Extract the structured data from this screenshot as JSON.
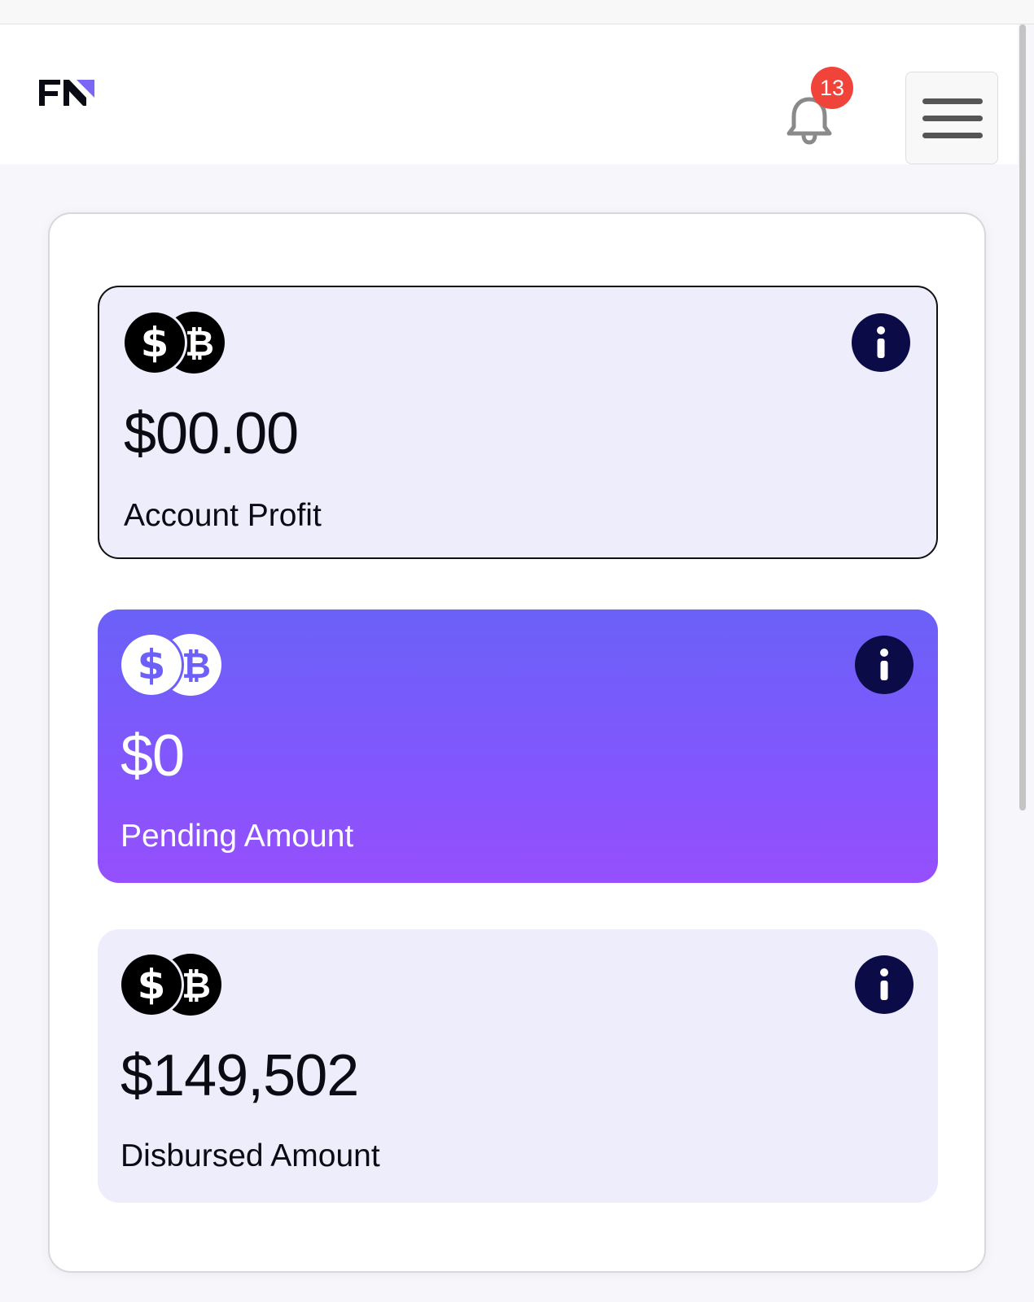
{
  "header": {
    "logo_text": "FN",
    "notification_count": "13",
    "icons": {
      "bell": "bell-icon",
      "menu": "hamburger-menu-icon"
    }
  },
  "cards": [
    {
      "amount": "$00.00",
      "label": "Account Profit",
      "style": "outlined",
      "icon": "dollar-bitcoin-coins-icon"
    },
    {
      "amount": "$0",
      "label": "Pending Amount",
      "style": "gradient",
      "icon": "dollar-bitcoin-coins-icon"
    },
    {
      "amount": "$149,502",
      "label": "Disbursed Amount",
      "style": "filled",
      "icon": "dollar-bitcoin-coins-icon"
    }
  ],
  "colors": {
    "accent_purple": "#7f58fd",
    "gradient_start": "#6a61f7",
    "gradient_end": "#964ffd",
    "card_bg": "#eeedfc",
    "info_icon": "#0b0b47",
    "badge": "#f0443a"
  }
}
